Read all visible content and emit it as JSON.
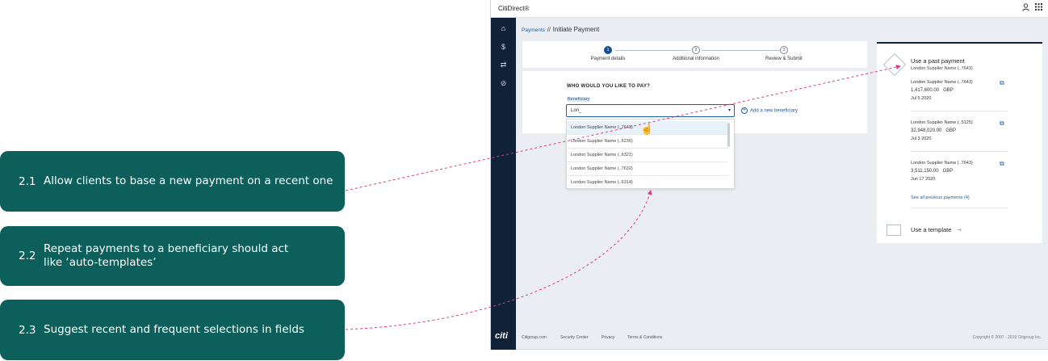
{
  "callouts": [
    {
      "num": "2.1",
      "text": "Allow clients to base a new payment on a recent one"
    },
    {
      "num": "2.2",
      "text": "Repeat payments to a beneficiary should act like ‘auto-templates’"
    },
    {
      "num": "2.3",
      "text": "Suggest recent and frequent selections in fields"
    }
  ],
  "app": {
    "brand": "CitiDirect®",
    "breadcrumb": {
      "parent": "Payments",
      "sep": "//",
      "current": "Initiate Payment"
    },
    "sidebar": {
      "home": "⌂",
      "dollar": "$",
      "transfer": "⇄",
      "link": "⊘",
      "logo": "citi"
    },
    "steps": [
      {
        "num": "1",
        "label": "Payment details"
      },
      {
        "num": "2",
        "label": "Additional information"
      },
      {
        "num": "3",
        "label": "Review & Submit"
      }
    ],
    "form": {
      "question": "WHO WOULD YOU LIKE TO PAY?",
      "field_label": "Beneficiary",
      "input_value": "Lon_",
      "add_beneficiary": "Add a new beneficiary"
    },
    "suggestions": [
      "London Supplier Name (..7643)",
      "London Supplier Name (..5236)",
      "London Supplier Name (..6321)",
      "London Supplier Name (..7632)",
      "London Supplier Name (..6314)"
    ],
    "past_payment": {
      "title": "Use a past payment",
      "subtitle": "London Supplier Name (..7643)",
      "items": [
        {
          "name": "London Supplier Name (..7643)",
          "amount": "1,417,600.00",
          "currency": "GBP",
          "date": "Jul 5 2020"
        },
        {
          "name": "London Supplier Name (..5125)",
          "amount": "32,948,020.00",
          "currency": "GBP",
          "date": "Jul 3 2020"
        },
        {
          "name": "London Supplier Name (..7643)",
          "amount": "3,511,150.00",
          "currency": "GBP",
          "date": "Jun 17 2020"
        }
      ],
      "see_all": "See all previous payments (4)",
      "template_label": "Use a template",
      "arrow": "→"
    },
    "footer": {
      "links": [
        "Citigroup.com",
        "Security Center",
        "Privacy",
        "Terms & Conditions"
      ],
      "copyright": "Copyright © 2007 - 2019 Citigroup Inc."
    }
  },
  "colors": {
    "callout_bg": "#0c5f5b",
    "sidebar_bg": "#0f2238",
    "link_blue": "#1a5ea8",
    "arrow_pink": "#e0378a"
  }
}
